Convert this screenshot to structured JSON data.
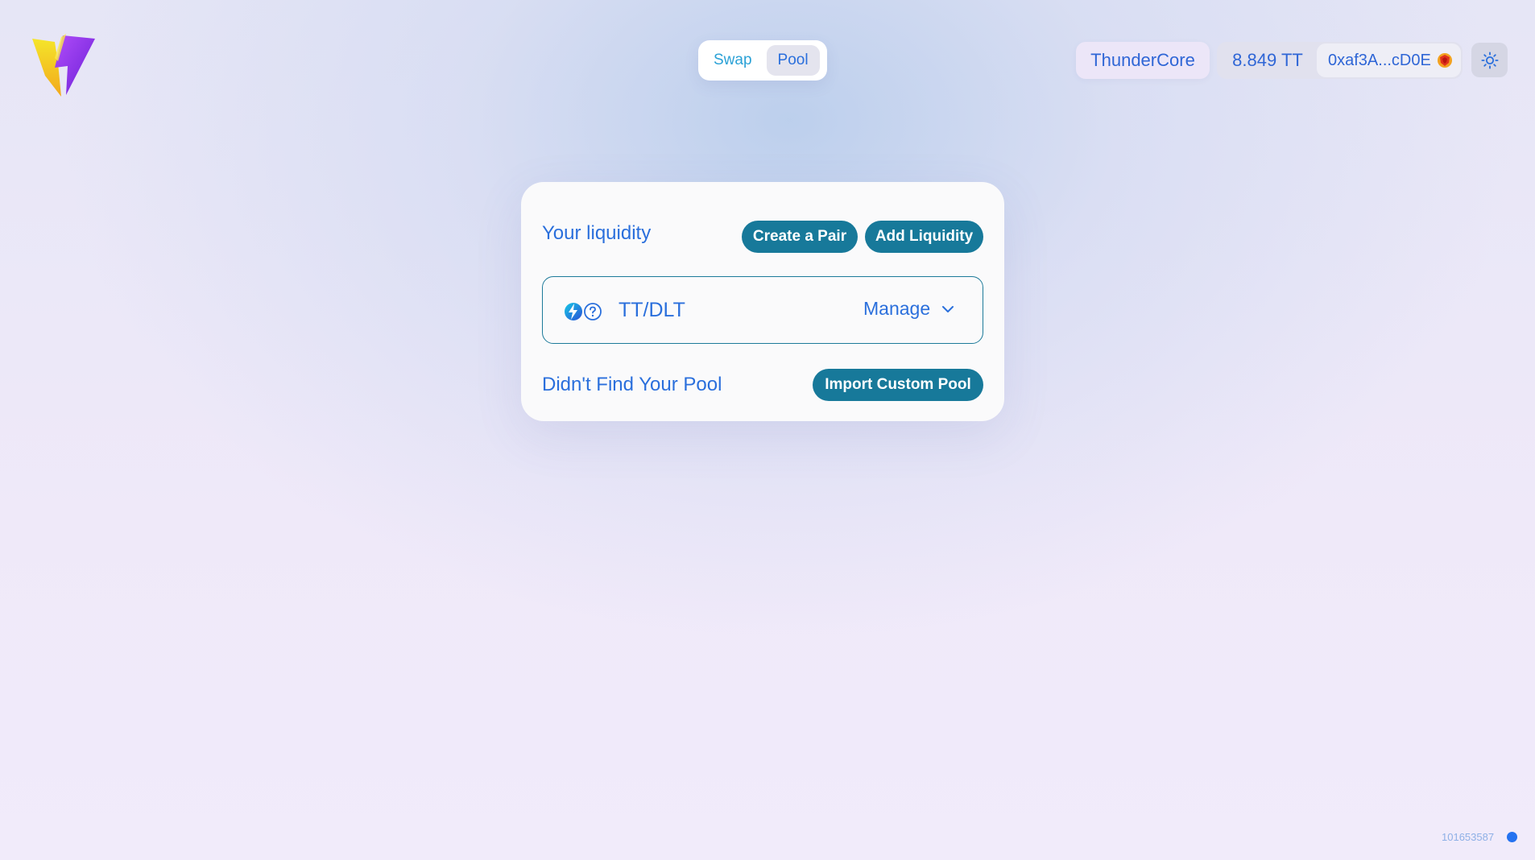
{
  "header": {
    "logo_icon": "lightning-bolt-logo",
    "nav": {
      "tabs": [
        {
          "label": "Swap",
          "active": false
        },
        {
          "label": "Pool",
          "active": true
        }
      ]
    },
    "network": "ThunderCore",
    "balance": "8.849 TT",
    "address": "0xaf3A...cD0E",
    "avatar_icon": "wallet-avatar-icon",
    "theme_icon": "sun-icon"
  },
  "card": {
    "title": "Your liquidity",
    "create_pair_label": "Create a Pair",
    "add_liquidity_label": "Add Liquidity",
    "pools": [
      {
        "pair": "TT/DLT",
        "manage_label": "Manage",
        "token_icons": [
          "tt-token-icon",
          "unknown-token-icon"
        ]
      }
    ],
    "footer_text": "Didn't Find Your Pool",
    "import_label": "Import Custom Pool"
  },
  "status": {
    "block_number": "101653587",
    "dot_color": "#2472f0"
  },
  "colors": {
    "accent": "#2a6fdc",
    "button": "#17799a"
  }
}
